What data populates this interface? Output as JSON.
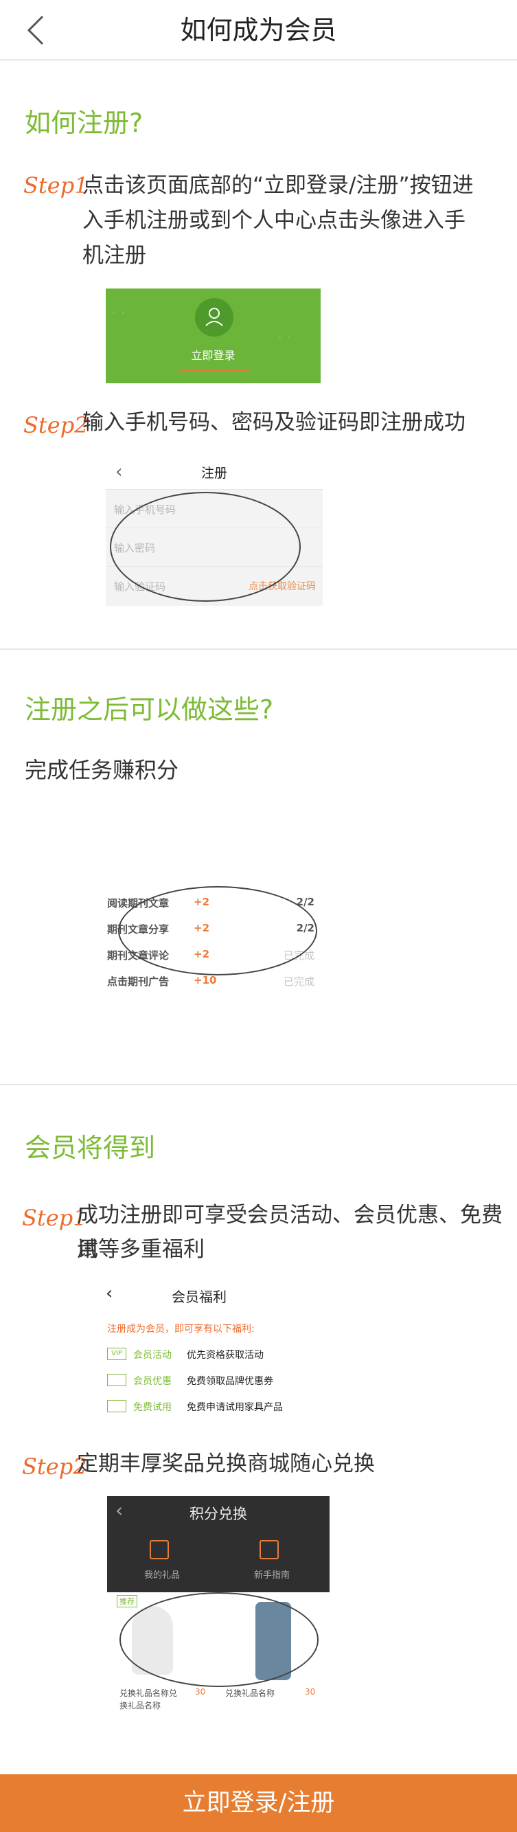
{
  "header": {
    "title": "如何成为会员"
  },
  "register": {
    "title": "如何注册?",
    "step1": {
      "label": "Step1",
      "text_line1": "点击该页面底部的“立即登录/注册”按钮进",
      "text_line2": "入手机注册或到个人中心点击头像进入手",
      "text_line3": "机注册",
      "card_label": "立即登录"
    },
    "step2": {
      "label": "Step2",
      "text": "输入手机号码、密码及验证码即注册成功",
      "form_title": "注册",
      "phone_placeholder": "输入手机号码",
      "password_placeholder": "输入密码",
      "code_placeholder": "输入验证码",
      "code_button": "点击获取验证码"
    }
  },
  "after_register": {
    "title": "注册之后可以做这些?",
    "subtitle": "完成任务赚积分",
    "tasks": [
      {
        "name": "阅读期刊文章",
        "points": "+2",
        "status": "2/2"
      },
      {
        "name": "期刊文章分享",
        "points": "+2",
        "status": "2/2"
      },
      {
        "name": "期刊文章评论",
        "points": "+2",
        "status": "已完成"
      },
      {
        "name": "点击期刊广告",
        "points": "+10",
        "status": "已完成"
      }
    ]
  },
  "member": {
    "title": "会员将得到",
    "step1": {
      "label": "Step1",
      "text_line1": "成功注册即可享受会员活动、会员优惠、免费试",
      "text_line2": "用等多重福利",
      "card_title": "会员福利",
      "card_note": "注册成为会员，即可享有以下福利:",
      "benefits": [
        {
          "icon": "VIP",
          "name": "会员活动",
          "desc": "优先资格获取活动"
        },
        {
          "icon": "",
          "name": "会员优惠",
          "desc": "免费领取品牌优惠券"
        },
        {
          "icon": "",
          "name": "免费试用",
          "desc": "免费申请试用家具产品"
        }
      ]
    },
    "step2": {
      "label": "Step2",
      "text": "定期丰厚奖品兑换商城随心兑换",
      "card_title": "积分兑换",
      "my_gifts": "我的礼品",
      "guide": "新手指南",
      "tag": "推荐",
      "item1_name_line1": "兑换礼品名称兑",
      "item1_name_line2": "换礼品名称",
      "item1_points": "30",
      "item2_name": "兑换礼品名称",
      "item2_points": "30"
    }
  },
  "cta": {
    "label": "立即登录/注册"
  }
}
